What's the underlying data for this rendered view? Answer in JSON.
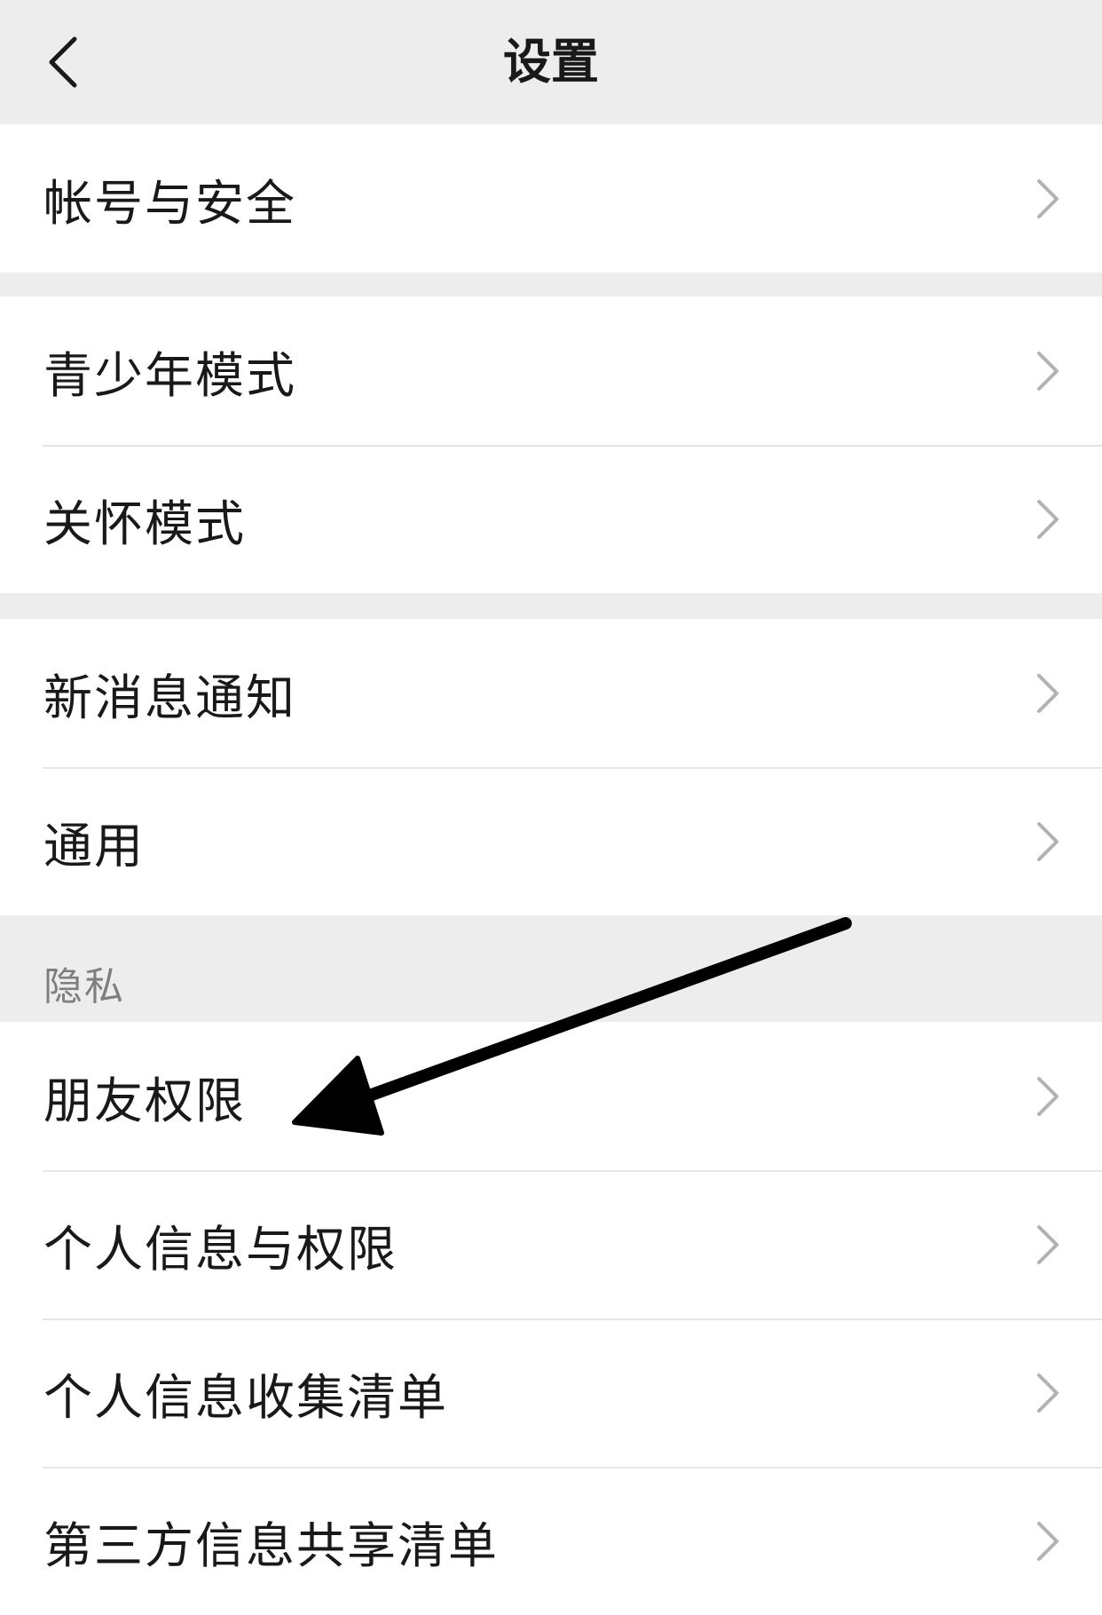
{
  "nav": {
    "title": "设置",
    "back_icon": "chevron-left-icon"
  },
  "groups": [
    {
      "items": [
        {
          "label": "帐号与安全"
        }
      ]
    },
    {
      "items": [
        {
          "label": "青少年模式"
        },
        {
          "label": "关怀模式"
        }
      ]
    },
    {
      "items": [
        {
          "label": "新消息通知"
        },
        {
          "label": "通用"
        }
      ]
    },
    {
      "title": "隐私",
      "items": [
        {
          "label": "朋友权限"
        },
        {
          "label": "个人信息与权限"
        },
        {
          "label": "个人信息收集清单"
        },
        {
          "label": "第三方信息共享清单"
        }
      ]
    }
  ],
  "chevron_icon": "chevron-right-icon",
  "annotation": {
    "type": "arrow",
    "color": "#000000",
    "points_to": "朋友权限"
  }
}
